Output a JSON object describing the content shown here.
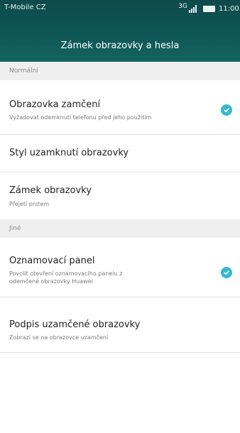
{
  "status_bar": {
    "carrier": "T-Mobile CZ",
    "network": "3G",
    "time": "11:00"
  },
  "header": {
    "title": "Zámek obrazovky a hesla"
  },
  "sections": [
    {
      "label": "Normální"
    },
    {
      "label": "Jiné"
    }
  ],
  "items": [
    {
      "title": "Obrazovka zamčení",
      "subtitle": "Vyžadovat odemknutí telefonu před jeho použitím",
      "checked": true
    },
    {
      "title": "Styl uzamknutí obrazovky"
    },
    {
      "title": "Zámek obrazovky",
      "subtitle": "Přejetí prstem"
    },
    {
      "title": "Oznamovací panel",
      "subtitle_line1": "Povolit otevření oznamovacího panelu z",
      "subtitle_line2": "odemčené obrazovky Huawei",
      "checked": true
    },
    {
      "title": "Podpis uzamčené obrazovky",
      "subtitle": "Zobrazí se na obrazovce uzamčení"
    }
  ],
  "colors": {
    "header_bg": "#0f5656",
    "accent": "#36b9cf"
  }
}
